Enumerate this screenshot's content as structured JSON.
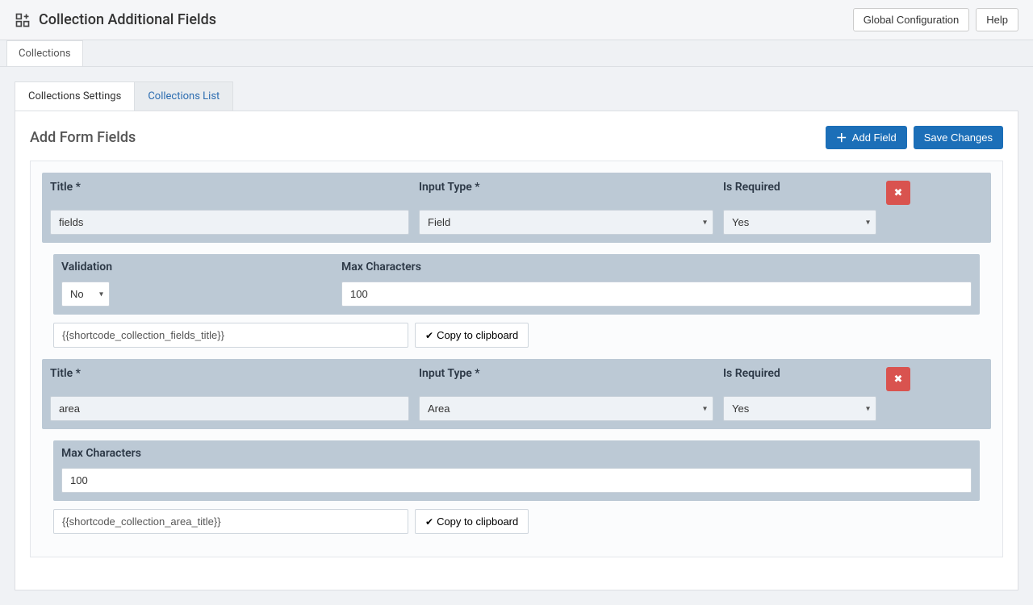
{
  "header": {
    "title": "Collection Additional Fields",
    "global_config": "Global Configuration",
    "help": "Help"
  },
  "tabs_bar": {
    "collections": "Collections"
  },
  "sub_tabs": {
    "settings": "Collections Settings",
    "list": "Collections List"
  },
  "panel": {
    "title": "Add Form Fields",
    "add_field": "Add Field",
    "save_changes": "Save Changes"
  },
  "labels": {
    "title": "Title *",
    "input_type": "Input Type *",
    "is_required": "Is Required",
    "validation": "Validation",
    "max_chars": "Max Characters",
    "copy": "Copy to clipboard"
  },
  "fields": [
    {
      "title_value": "fields",
      "input_type_value": "Field",
      "is_required_value": "Yes",
      "has_validation": true,
      "validation_value": "No",
      "max_chars_value": "100",
      "shortcode": "{{shortcode_collection_fields_title}}"
    },
    {
      "title_value": "area",
      "input_type_value": "Area",
      "is_required_value": "Yes",
      "has_validation": false,
      "max_chars_value": "100",
      "shortcode": "{{shortcode_collection_area_title}}"
    }
  ]
}
